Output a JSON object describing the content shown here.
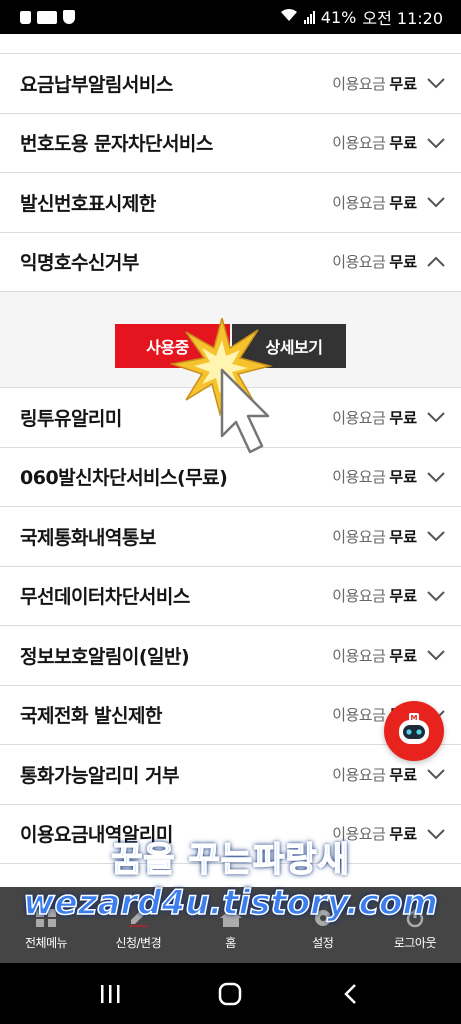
{
  "status_bar": {
    "battery": "41%",
    "time": "오전 11:20"
  },
  "fee_label": "이용요금",
  "fee_value": "무료",
  "services_top": [
    {
      "title": "요금납부알림서비스",
      "state": "collapsed"
    },
    {
      "title": "번호도용 문자차단서비스",
      "state": "collapsed"
    },
    {
      "title": "발신번호표시제한",
      "state": "collapsed"
    },
    {
      "title": "익명호수신거부",
      "state": "expanded"
    }
  ],
  "expanded_panel": {
    "primary_button": "사용중",
    "secondary_button": "상세보기"
  },
  "services_bottom": [
    {
      "title": "링투유알리미",
      "state": "collapsed"
    },
    {
      "title": "060발신차단서비스(무료)",
      "state": "collapsed"
    },
    {
      "title": "국제통화내역통보",
      "state": "collapsed"
    },
    {
      "title": "무선데이터차단서비스",
      "state": "collapsed"
    },
    {
      "title": "정보보호알림이(일반)",
      "state": "collapsed"
    },
    {
      "title": "국제전화 발신제한",
      "state": "collapsed"
    },
    {
      "title": "통화가능알리미 거부",
      "state": "collapsed"
    },
    {
      "title": "이용요금내역알리미",
      "state": "collapsed"
    }
  ],
  "bottom_nav": [
    {
      "label": "전체메뉴",
      "icon": "grid-icon"
    },
    {
      "label": "신청/변경",
      "icon": "edit-icon"
    },
    {
      "label": "홈",
      "icon": "home-icon"
    },
    {
      "label": "설정",
      "icon": "gear-icon"
    },
    {
      "label": "로그아웃",
      "icon": "power-icon"
    }
  ],
  "watermark": {
    "line1": "꿈을 꾸는파랑새",
    "line2": "wezard4u.tistory.com"
  },
  "colors": {
    "accent_red": "#e4151f",
    "dark_button": "#333333",
    "nav_bg": "#454545"
  }
}
